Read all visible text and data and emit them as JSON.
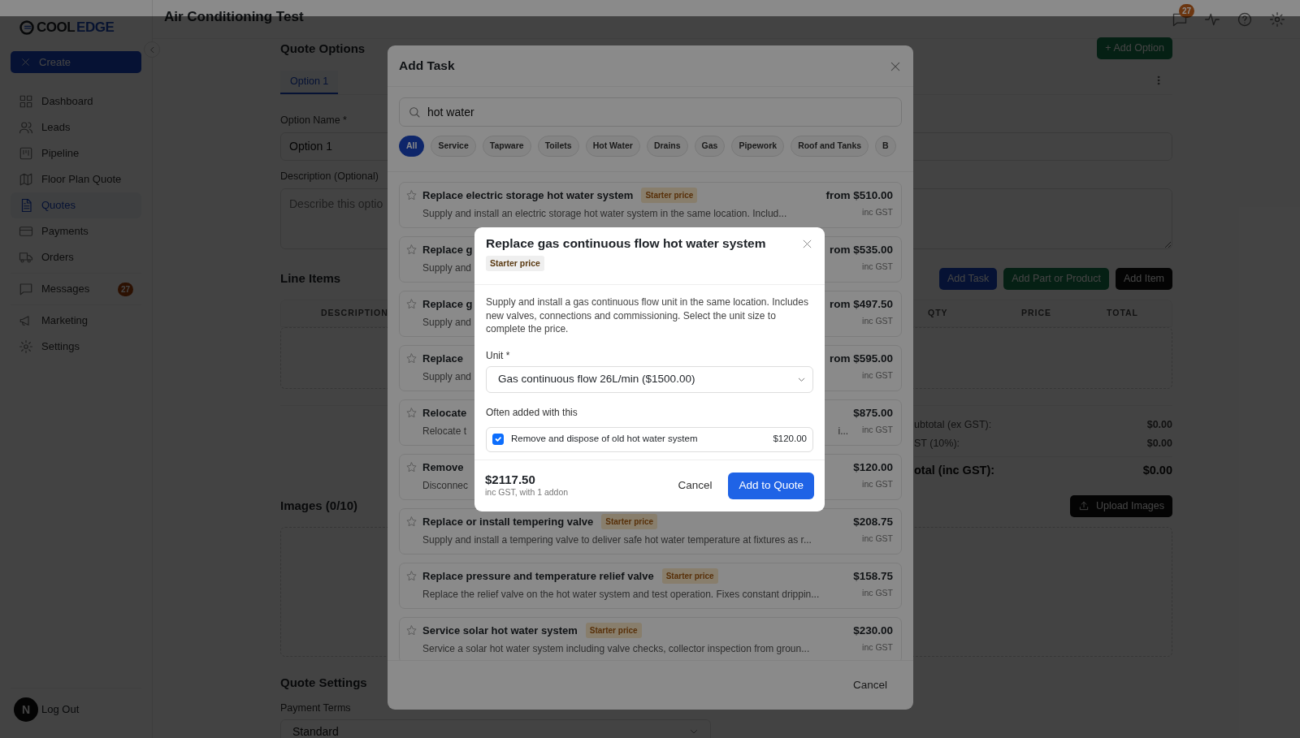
{
  "sidebar": {
    "logo": {
      "first": "COOL",
      "second": "EDGE"
    },
    "create": "Create",
    "groups": [
      {
        "items": [
          {
            "label": "Dashboard",
            "selected": false
          },
          {
            "label": "Leads",
            "selected": false
          },
          {
            "label": "Pipeline",
            "selected": false
          },
          {
            "label": "Floor Plan Quote",
            "selected": false
          },
          {
            "label": "Quotes",
            "selected": true
          },
          {
            "label": "Payments",
            "selected": false
          },
          {
            "label": "Orders",
            "selected": false
          }
        ]
      },
      {
        "items": [
          {
            "label": "Messages",
            "selected": false,
            "badge": "27"
          }
        ]
      },
      {
        "items": [
          {
            "label": "Marketing",
            "selected": false
          },
          {
            "label": "Settings",
            "selected": false
          }
        ]
      }
    ],
    "avatar": "N",
    "logout": "Log Out"
  },
  "header": {
    "title": "Air Conditioning Test",
    "messages_badge": "27"
  },
  "quote": {
    "title": "Quote Options",
    "add_option": "+ Add Option",
    "tabs": [
      {
        "label": "Option 1",
        "selected": true
      }
    ],
    "option_name": {
      "label": "Option Name *",
      "value": "Option 1"
    },
    "description": {
      "label": "Description (Optional)",
      "placeholder": "Describe this optio"
    },
    "line_items": {
      "title": "Line Items",
      "buttons": [
        {
          "label": "Add Task",
          "kind": "primary"
        },
        {
          "label": "Add Part or Product",
          "kind": "success"
        },
        {
          "label": "Add Item",
          "kind": "dark"
        }
      ],
      "columns": [
        "DESCRIPTION",
        "QTY",
        "PRICE",
        "TOTAL"
      ]
    },
    "totals": [
      {
        "label": "ubtotal (ex GST):",
        "value": "$0.00",
        "kind": "line"
      },
      {
        "label": "ST (10%):",
        "value": "$0.00",
        "kind": "line"
      },
      {
        "label": "otal (inc GST):",
        "value": "$0.00",
        "kind": "total"
      }
    ],
    "images": {
      "title": "Images (0/10)",
      "upload": "Upload Images"
    },
    "settings": {
      "title": "Quote Settings",
      "payment_terms": {
        "label": "Payment Terms",
        "value": "Standard"
      }
    }
  },
  "add_task": {
    "title": "Add Task",
    "search": {
      "value": "hot water"
    },
    "chips": [
      {
        "label": "All",
        "selected": true
      },
      {
        "label": "Service",
        "selected": false
      },
      {
        "label": "Tapware",
        "selected": false
      },
      {
        "label": "Toilets",
        "selected": false
      },
      {
        "label": "Hot Water",
        "selected": false
      },
      {
        "label": "Drains",
        "selected": false
      },
      {
        "label": "Gas",
        "selected": false
      },
      {
        "label": "Pipework",
        "selected": false
      },
      {
        "label": "Roof and Tanks",
        "selected": false
      },
      {
        "label": "B",
        "selected": false
      }
    ],
    "tasks": [
      {
        "title": "Replace electric storage hot water system",
        "badge": "Starter price",
        "description": "Supply and install an electric storage hot water system in the same location. Includ...",
        "price": "from $510.00",
        "price_note": "inc GST"
      },
      {
        "title": "Replace g",
        "description": "Supply and",
        "price": "rom $535.00",
        "price_note": "inc GST"
      },
      {
        "title": "Replace g",
        "description": "Supply and",
        "price": "rom $497.50",
        "price_note": "inc GST"
      },
      {
        "title": "Replace",
        "description": "Supply and",
        "price": "rom $595.00",
        "price_note": "inc GST"
      },
      {
        "title": "Relocate",
        "description": "Relocate t",
        "description_end": "i...",
        "price": "$875.00",
        "price_note": "inc GST"
      },
      {
        "title": "Remove",
        "description": "Disconnec",
        "price": "$120.00",
        "price_note": "inc GST"
      },
      {
        "title": "Replace or install tempering valve",
        "badge": "Starter price",
        "description": "Supply and install a tempering valve to deliver safe hot water temperature at fixtures as r...",
        "price": "$208.75",
        "price_note": "inc GST"
      },
      {
        "title": "Replace pressure and temperature relief valve",
        "badge": "Starter price",
        "description": "Replace the relief valve on the hot water system and test operation. Fixes constant drippin...",
        "price": "$158.75",
        "price_note": "inc GST"
      },
      {
        "title": "Service solar hot water system",
        "badge": "Starter price",
        "description": "Service a solar hot water system including valve checks, collector inspection from groun...",
        "price": "$230.00",
        "price_note": "inc GST"
      }
    ],
    "cancel": "Cancel"
  },
  "task_detail": {
    "title": "Replace gas continuous flow hot water system",
    "badge": "Starter price",
    "description": "Supply and install a gas continuous flow unit in the same location. Includes new valves, connections and commissioning. Select the unit size to complete the price.",
    "unit": {
      "label": "Unit *",
      "value": "Gas continuous flow 26L/min ($1500.00)"
    },
    "addons_label": "Often added with this",
    "addons": [
      {
        "label": "Remove and dispose of old hot water system",
        "price": "$120.00",
        "checked": true
      }
    ],
    "total": "$2117.50",
    "total_note": "inc GST, with 1 addon",
    "cancel": "Cancel",
    "submit": "Add to Quote"
  }
}
